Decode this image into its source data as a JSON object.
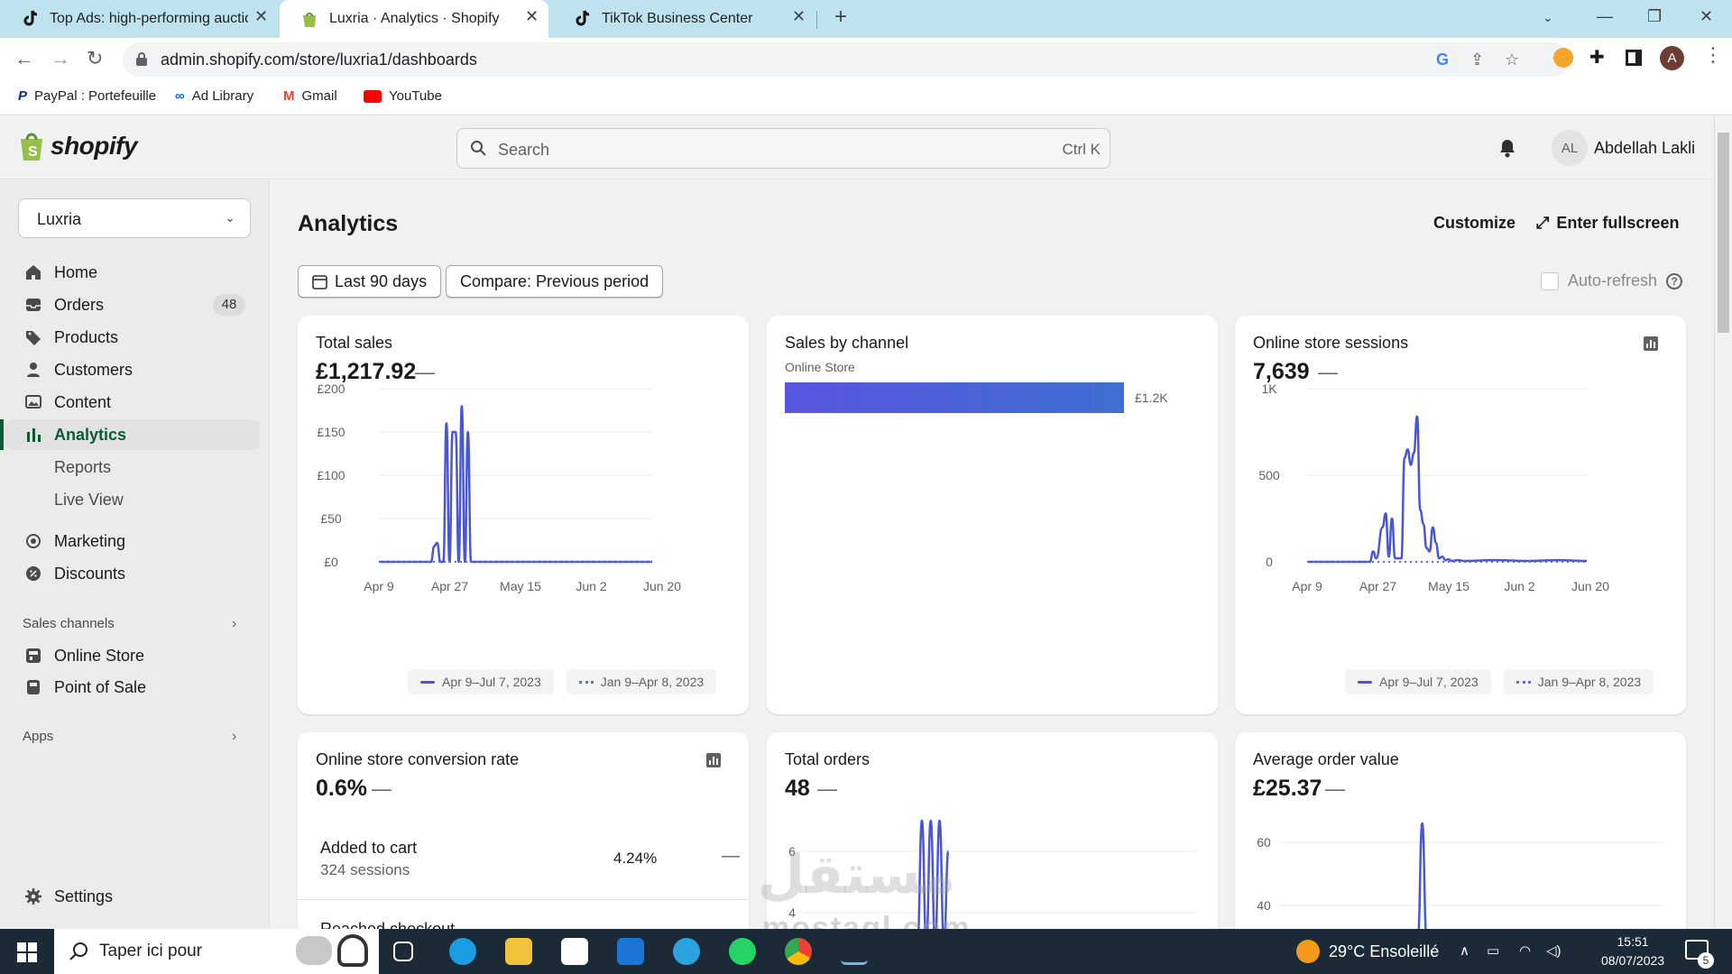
{
  "browser": {
    "tabs": [
      {
        "title": "Top Ads: high-performing auctio",
        "active": false
      },
      {
        "title": "Luxria · Analytics · Shopify",
        "active": true
      },
      {
        "title": "TikTok Business Center",
        "active": false
      }
    ],
    "url": "admin.shopify.com/store/luxria1/dashboards",
    "profile_initial": "A",
    "bookmarks": [
      "PayPal : Portefeuille",
      "Ad Library",
      "Gmail",
      "YouTube"
    ]
  },
  "topbar": {
    "logo_text": "shopify",
    "search_placeholder": "Search",
    "search_shortcut": "Ctrl K",
    "avatar_initials": "AL",
    "user_name": "Abdellah Lakli"
  },
  "sidebar": {
    "store_name": "Luxria",
    "items": [
      {
        "label": "Home",
        "icon": "home-icon"
      },
      {
        "label": "Orders",
        "icon": "inbox-icon",
        "badge": "48"
      },
      {
        "label": "Products",
        "icon": "tag-icon"
      },
      {
        "label": "Customers",
        "icon": "person-icon"
      },
      {
        "label": "Content",
        "icon": "image-icon"
      },
      {
        "label": "Analytics",
        "icon": "bar-chart-icon",
        "active": true
      },
      {
        "label": "Reports"
      },
      {
        "label": "Live View"
      },
      {
        "label": "Marketing",
        "icon": "target-icon"
      },
      {
        "label": "Discounts",
        "icon": "discount-icon"
      }
    ],
    "sales_channels_label": "Sales channels",
    "channels": [
      {
        "label": "Online Store",
        "icon": "store-icon"
      },
      {
        "label": "Point of Sale",
        "icon": "pos-icon"
      }
    ],
    "apps_label": "Apps",
    "settings_label": "Settings"
  },
  "main": {
    "title": "Analytics",
    "customize_label": "Customize",
    "fullscreen_label": "Enter fullscreen",
    "date_range_label": "Last 90 days",
    "compare_label": "Compare: Previous period",
    "autorefresh_label": "Auto-refresh",
    "cards": {
      "total_sales": {
        "title": "Total sales",
        "value": "£1,217.92",
        "change": "—"
      },
      "sales_by_channel": {
        "title": "Sales by channel"
      },
      "sessions": {
        "title": "Online store sessions",
        "value": "7,639",
        "change": "—"
      },
      "conversion": {
        "title": "Online store conversion rate",
        "value": "0.6%",
        "change": "—",
        "rows": [
          {
            "label": "Added to cart",
            "sub": "324 sessions",
            "pct": "4.24%",
            "change": "—"
          },
          {
            "label": "Reached checkout"
          }
        ]
      },
      "total_orders": {
        "title": "Total orders",
        "value": "48",
        "change": "—"
      },
      "aov": {
        "title": "Average order value",
        "value": "£25.37",
        "change": "—"
      }
    },
    "legend": {
      "current": "Apr 9–Jul 7, 2023",
      "previous": "Jan 9–Apr 8, 2023"
    }
  },
  "chart_data": [
    {
      "type": "line",
      "title": "Total sales",
      "x_ticks": [
        "Apr 9",
        "Apr 27",
        "May 15",
        "Jun 2",
        "Jun 20"
      ],
      "y_ticks": [
        "£0",
        "£50",
        "£100",
        "£150",
        "£200"
      ],
      "ylim": [
        0,
        200
      ],
      "series": [
        {
          "name": "Apr 9–Jul 7, 2023",
          "style": "solid",
          "color": "#4b56d2",
          "x": [
            0,
            17,
            18,
            19,
            20,
            21,
            22,
            23,
            24,
            25,
            26,
            27,
            28,
            29,
            30,
            31,
            32,
            33,
            34,
            35,
            89
          ],
          "values": [
            0,
            0,
            18,
            22,
            0,
            0,
            160,
            0,
            150,
            150,
            0,
            180,
            0,
            150,
            0,
            0,
            0,
            0,
            0,
            0,
            0
          ]
        },
        {
          "name": "Jan 9–Apr 8, 2023",
          "style": "dotted",
          "color": "#5a6fd6",
          "x": [
            0,
            89
          ],
          "values": [
            0,
            0
          ]
        }
      ]
    },
    {
      "type": "bar",
      "title": "Sales by channel",
      "categories": [
        "Online Store"
      ],
      "values": [
        1217.92
      ],
      "labels": [
        "£1.2K"
      ],
      "color": "#5a55e0"
    },
    {
      "type": "line",
      "title": "Online store sessions",
      "x_ticks": [
        "Apr 9",
        "Apr 27",
        "May 15",
        "Jun 2",
        "Jun 20"
      ],
      "y_ticks": [
        "0",
        "500",
        "1K"
      ],
      "ylim": [
        0,
        1000
      ],
      "series": [
        {
          "name": "Apr 9–Jul 7, 2023",
          "style": "solid",
          "color": "#4b56d2",
          "x": [
            0,
            20,
            21,
            22,
            24,
            25,
            26,
            27,
            28,
            30,
            31,
            32,
            33,
            34,
            35,
            36,
            37,
            38,
            39,
            40,
            41,
            42,
            43,
            44,
            45,
            46,
            48,
            50,
            60,
            70,
            80,
            89
          ],
          "values": [
            0,
            0,
            60,
            20,
            200,
            280,
            30,
            250,
            20,
            20,
            600,
            650,
            560,
            630,
            840,
            300,
            220,
            80,
            60,
            200,
            110,
            20,
            30,
            10,
            15,
            5,
            10,
            5,
            10,
            5,
            10,
            5
          ]
        },
        {
          "name": "Jan 9–Apr 8, 2023",
          "style": "dotted",
          "color": "#5a6fd6",
          "x": [
            0,
            89
          ],
          "values": [
            0,
            0
          ]
        }
      ]
    },
    {
      "type": "line",
      "title": "Total orders",
      "y_ticks": [
        "4",
        "6"
      ],
      "series": [
        {
          "name": "Apr 9–Jul 7, 2023",
          "style": "solid",
          "color": "#4b56d2",
          "x": [
            26,
            27,
            28,
            29,
            30,
            31,
            32,
            33
          ],
          "values": [
            3,
            7,
            3,
            7,
            3,
            7,
            3,
            6
          ]
        }
      ]
    },
    {
      "type": "line",
      "title": "Average order value",
      "y_ticks": [
        "40",
        "60"
      ],
      "series": [
        {
          "name": "Apr 9–Jul 7, 2023",
          "style": "solid",
          "color": "#4b56d2",
          "x": [
            32,
            33,
            34
          ],
          "values": [
            30,
            66,
            30
          ]
        }
      ]
    }
  ],
  "taskbar": {
    "search_text": "Taper ici pour",
    "weather": "29°C  Ensoleillé",
    "time": "15:51",
    "date": "08/07/2023",
    "notifications": "5"
  },
  "watermark": {
    "arabic": "مستقل",
    "latin": "mostaql.com"
  }
}
